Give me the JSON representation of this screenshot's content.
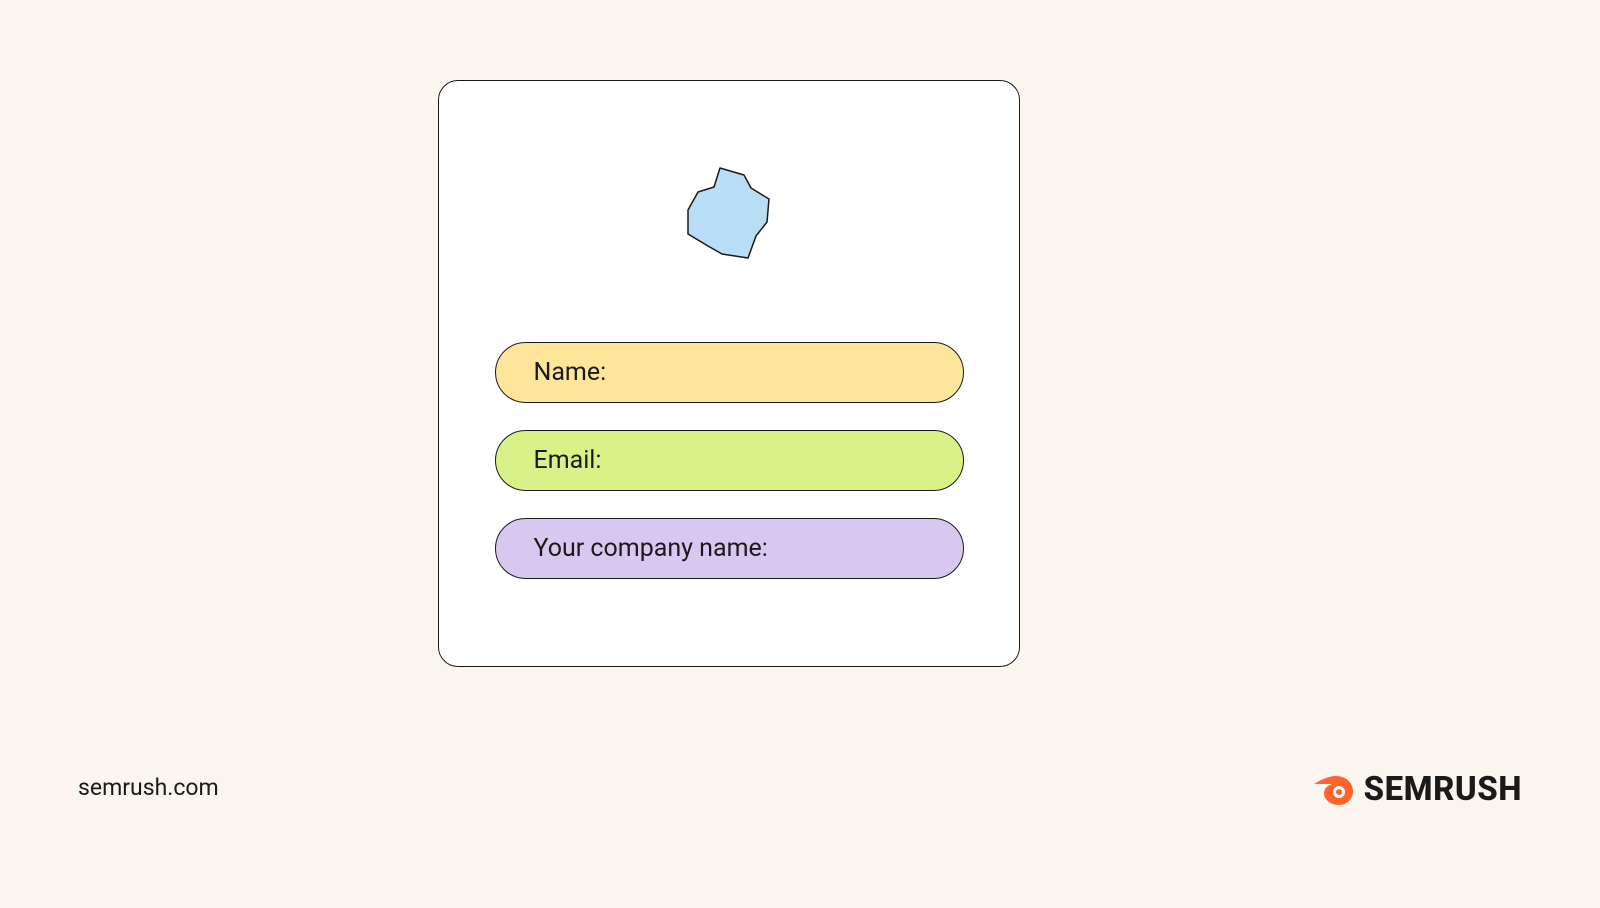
{
  "fields": {
    "name": "Name:",
    "email": "Email:",
    "company": "Your company name:"
  },
  "footer": {
    "site": "semrush.com",
    "brand": "SEMRUSH"
  },
  "colors": {
    "blob": "#b9ddf4",
    "brand_accent": "#ff642d"
  }
}
